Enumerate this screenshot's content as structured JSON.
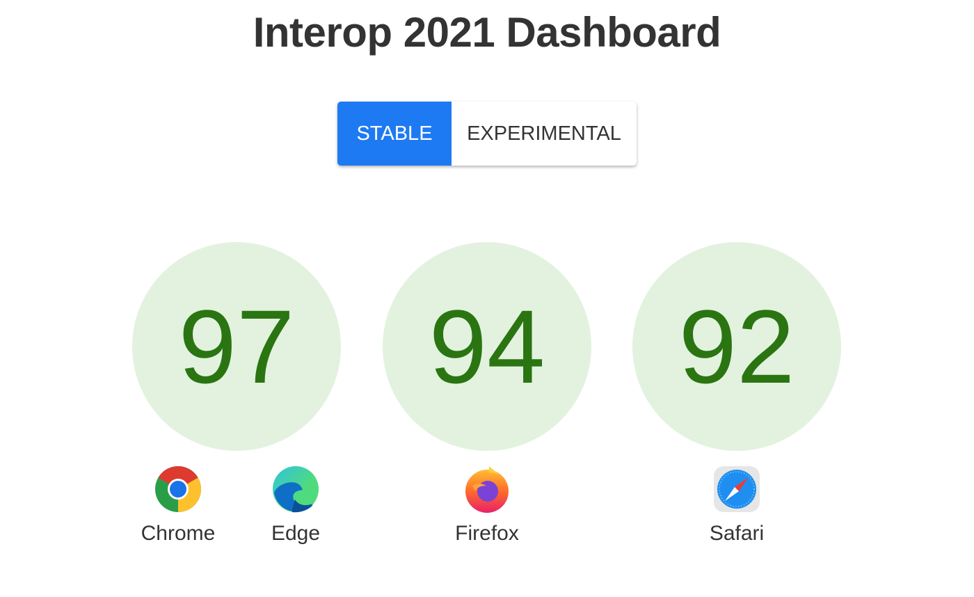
{
  "header": {
    "title": "Interop 2021 Dashboard"
  },
  "toggle": {
    "options": [
      {
        "label": "STABLE",
        "selected": true
      },
      {
        "label": "EXPERIMENTAL",
        "selected": false
      }
    ]
  },
  "scores": [
    {
      "value": "97",
      "browsers": [
        "Chrome",
        "Edge"
      ]
    },
    {
      "value": "94",
      "browsers": [
        "Firefox"
      ]
    },
    {
      "value": "92",
      "browsers": [
        "Safari"
      ]
    }
  ],
  "browsers": {
    "chrome": "Chrome",
    "edge": "Edge",
    "firefox": "Firefox",
    "safari": "Safari"
  },
  "colors": {
    "accent": "#1e7af2",
    "score_bg": "#e2f2df",
    "score_text": "#2a7512"
  }
}
